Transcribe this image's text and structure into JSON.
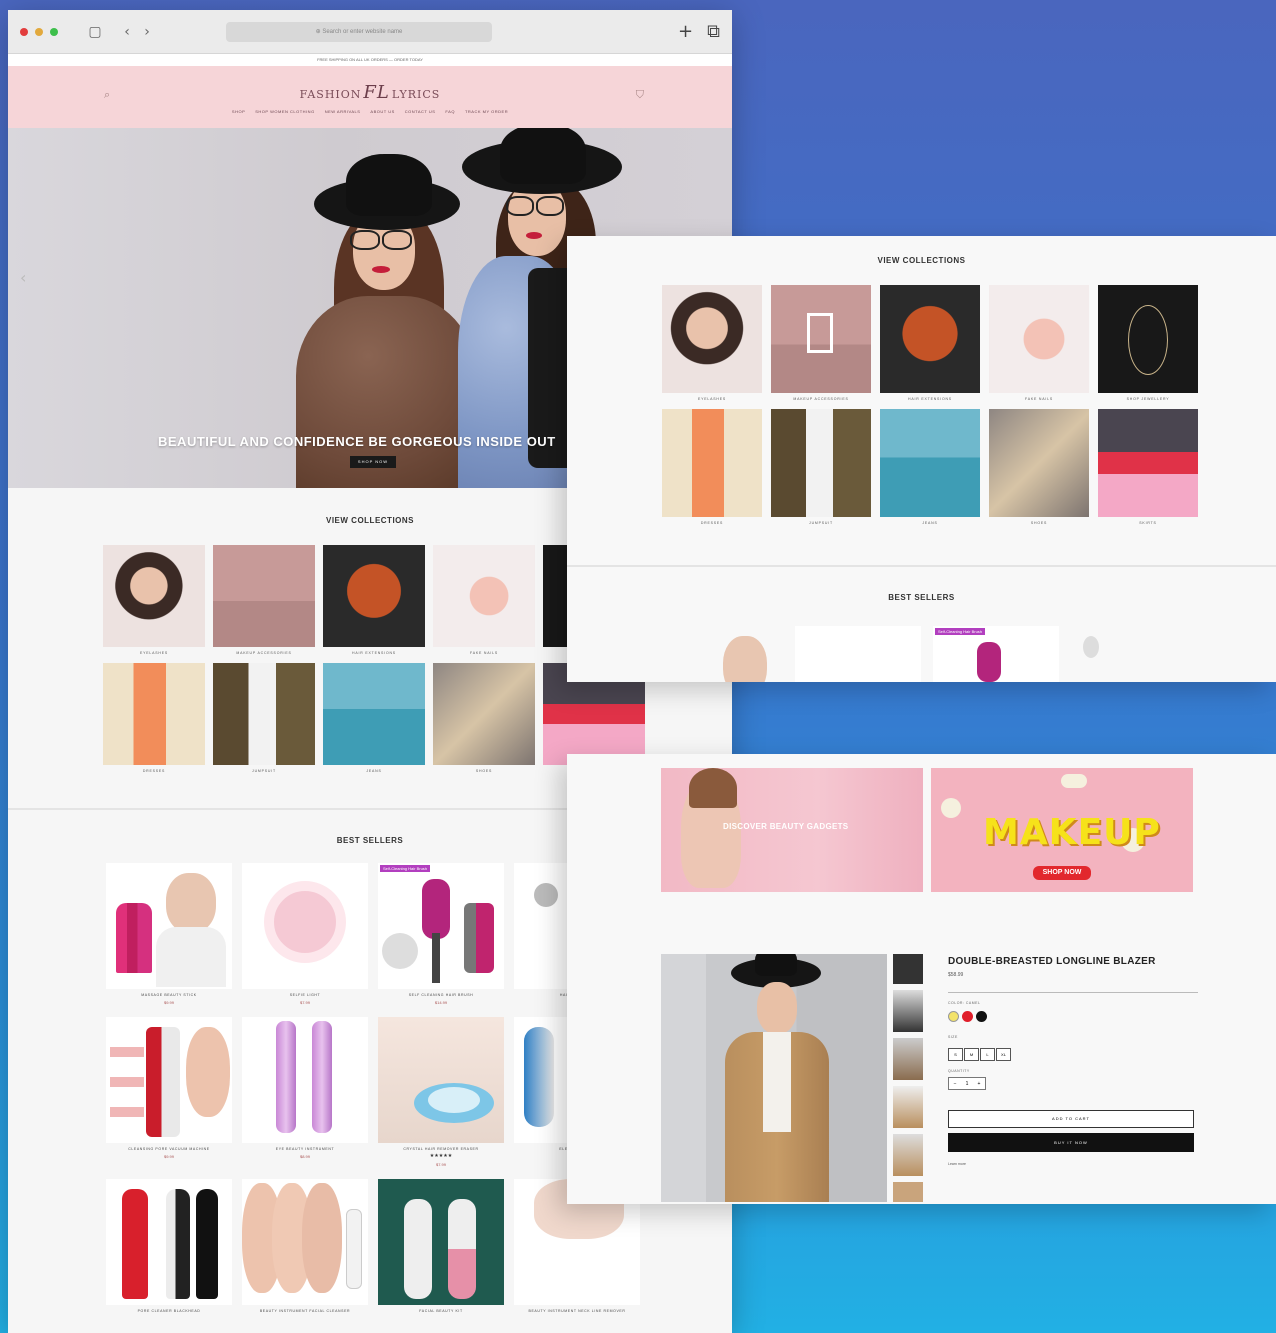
{
  "browser": {
    "address": "⊕ Search or enter website name",
    "announcement": "FREE SHIPPING ON ALL UK ORDERS — ORDER TODAY"
  },
  "header": {
    "logo_left": "FASHION",
    "logo_mark": "FL",
    "logo_right": "LYRICS",
    "nav": [
      "SHOP",
      "SHOP WOMEN CLOTHING",
      "NEW ARRIVALS",
      "ABOUT US",
      "CONTACT US",
      "FAQ",
      "TRACK MY ORDER"
    ]
  },
  "hero": {
    "caption": "BEAUTIFUL AND CONFIDENCE BE GORGEOUS INSIDE OUT",
    "button": "SHOP NOW"
  },
  "collections": {
    "title": "VIEW COLLECTIONS",
    "items": [
      "EYELASHES",
      "MAKEUP ACCESSORIES",
      "HAIR EXTENSIONS",
      "FAKE NAILS",
      "SHOP JEWELLERY",
      "DRESSES",
      "JUMPSUIT",
      "JEANS",
      "SHOES",
      "SKIRTS"
    ]
  },
  "bestsellers": {
    "title": "BEST SELLERS",
    "badge": "Self-Cleaning Hair Brush",
    "products": [
      {
        "name": "MASSAGE BEAUTY STICK",
        "price": "$9.99"
      },
      {
        "name": "SELFIE LIGHT",
        "price": "$7.99"
      },
      {
        "name": "SELF CLEANING HAIR BRUSH",
        "price": "$14.99"
      },
      {
        "name": "HAIR REMOVER",
        "price": ""
      },
      {
        "name": "CLEANSING PORE VACUUM MACHINE",
        "price": "$9.99"
      },
      {
        "name": "EYE BEAUTY INSTRUMENT",
        "price": "$8.99"
      },
      {
        "name": "CRYSTAL HAIR REMOVER ERASER",
        "price": "$7.99",
        "rating": "★★★★★"
      },
      {
        "name": "ELECTRIC FACE",
        "price": ""
      },
      {
        "name": "PORE CLEANER BLACKHEAD",
        "price": ""
      },
      {
        "name": "BEAUTY INSTRUMENT FACIAL CLEANSER",
        "price": ""
      },
      {
        "name": "FACIAL BEAUTY KIT",
        "price": ""
      },
      {
        "name": "BEAUTY INSTRUMENT NECK LINE REMOVER",
        "price": ""
      }
    ]
  },
  "promo": {
    "left_text": "DISCOVER BEAUTY GADGETS",
    "right_title": "MAKEUP",
    "right_button": "SHOP NOW"
  },
  "product_detail": {
    "title": "DOUBLE-BREASTED LONGLINE BLAZER",
    "price": "$58.99",
    "color_label": "COLOR: CAMEL",
    "size_label": "SIZE",
    "sizes": [
      "S",
      "M",
      "L",
      "XL"
    ],
    "quantity_label": "QUANTITY",
    "quantity": "1",
    "add_to_cart": "ADD TO CART",
    "buy_now": "BUY IT NOW",
    "more": "Learn more",
    "swatch_colors": [
      "#f3e36a",
      "#e01e2a",
      "#111111"
    ]
  },
  "colors": {
    "header_pink": "#f6d5d8",
    "accent_purple": "#b23fbf",
    "button_black": "#111111"
  }
}
